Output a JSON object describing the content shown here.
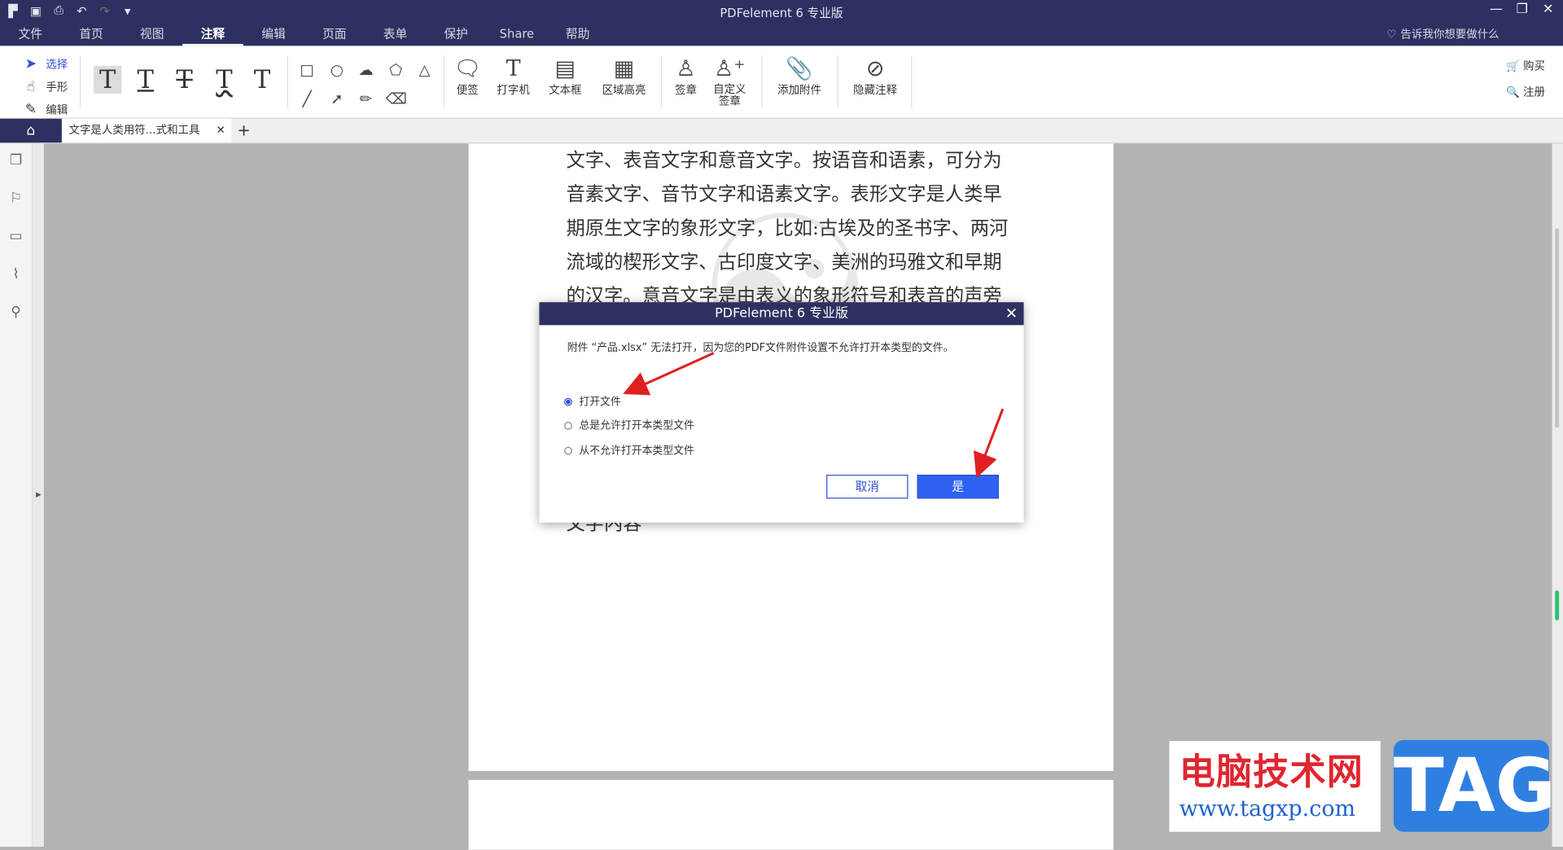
{
  "app": {
    "title": "PDFelement  6 专业版",
    "quick_access": [
      "menu-icon",
      "save-icon",
      "print-icon",
      "undo-icon",
      "redo-icon",
      "customize-icon"
    ],
    "window_controls": [
      "—",
      "❐",
      "✕"
    ]
  },
  "menu": [
    "文件",
    "首页",
    "视图",
    "注释",
    "编辑",
    "页面",
    "表单",
    "保护",
    "Share",
    "帮助"
  ],
  "active_menu": "注释",
  "tell_me": "告诉我你想要做什么",
  "toolbar": {
    "modes": [
      "选择",
      "手形",
      "编辑"
    ],
    "text_tools": [
      "T",
      "T",
      "T",
      "T",
      "T"
    ],
    "big_tools": [
      {
        "label": "便签"
      },
      {
        "label": "打字机"
      },
      {
        "label": "文本框"
      },
      {
        "label": "区域高亮"
      },
      {
        "label": "签章"
      },
      {
        "label": "自定义\n签章"
      },
      {
        "label": "添加附件"
      },
      {
        "label": "隐藏注释"
      }
    ],
    "right": [
      "购买",
      "注册"
    ]
  },
  "tab": {
    "title": "文字是人类用符...式和工具",
    "close": "✕",
    "new": "+"
  },
  "document": {
    "lines": [
      "文字、表音文字和意音文字。按语音和语素，可分为",
      "音素文字、音节文字和语素文字。表形文字是人类早",
      "期原生文字的象形文字，比如:古埃及的圣书字、两河",
      "流域的楔形文字、古印度文字、美洲的玛雅文和早期",
      "的汉字。意音文字是由表义的象形符号和表音的声旁"
    ],
    "partial_line": "文字内容"
  },
  "dialog": {
    "title": "PDFelement  6 专业版",
    "message": "附件 “产品.xlsx” 无法打开，因为您的PDF文件附件设置不允许打开本类型的文件。",
    "options": [
      "打开文件",
      "总是允许打开本类型文件",
      "从不允许打开本类型文件"
    ],
    "selected_option": 0,
    "cancel": "取消",
    "confirm": "是",
    "accent": "#2f62f0"
  },
  "site_watermark": {
    "cn": "电脑技术网",
    "url": "www.tagxp.com",
    "tag": "TAG"
  },
  "colors": {
    "titlebar": "#2d3161",
    "annotation_arrow": "#e02020"
  }
}
